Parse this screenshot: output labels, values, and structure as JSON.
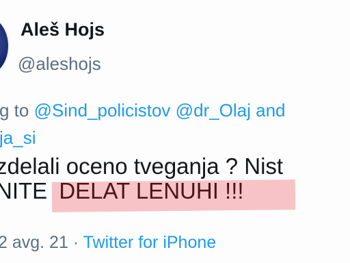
{
  "author": {
    "display_name": "Aleš Hojs",
    "handle": "@aleshojs"
  },
  "reply": {
    "prefix": "g to",
    "mention_1": "@Sind_policistov",
    "mention_2": "@dr_Olaj",
    "and_text": "and",
    "mention_3": "ja_si"
  },
  "tweet": {
    "line_1": "zdelali oceno tveganja ? Nist",
    "line_2_prefix": "NITE",
    "line_2_highlight": "DELAT LENUHI !!!"
  },
  "meta": {
    "date": "2 avg. 21",
    "separator": "·",
    "source": "Twitter for iPhone"
  },
  "colors": {
    "link": "#1d9bf0",
    "secondary_text": "#5b7083",
    "primary_text": "#14171a",
    "highlight": "#ee646e"
  }
}
